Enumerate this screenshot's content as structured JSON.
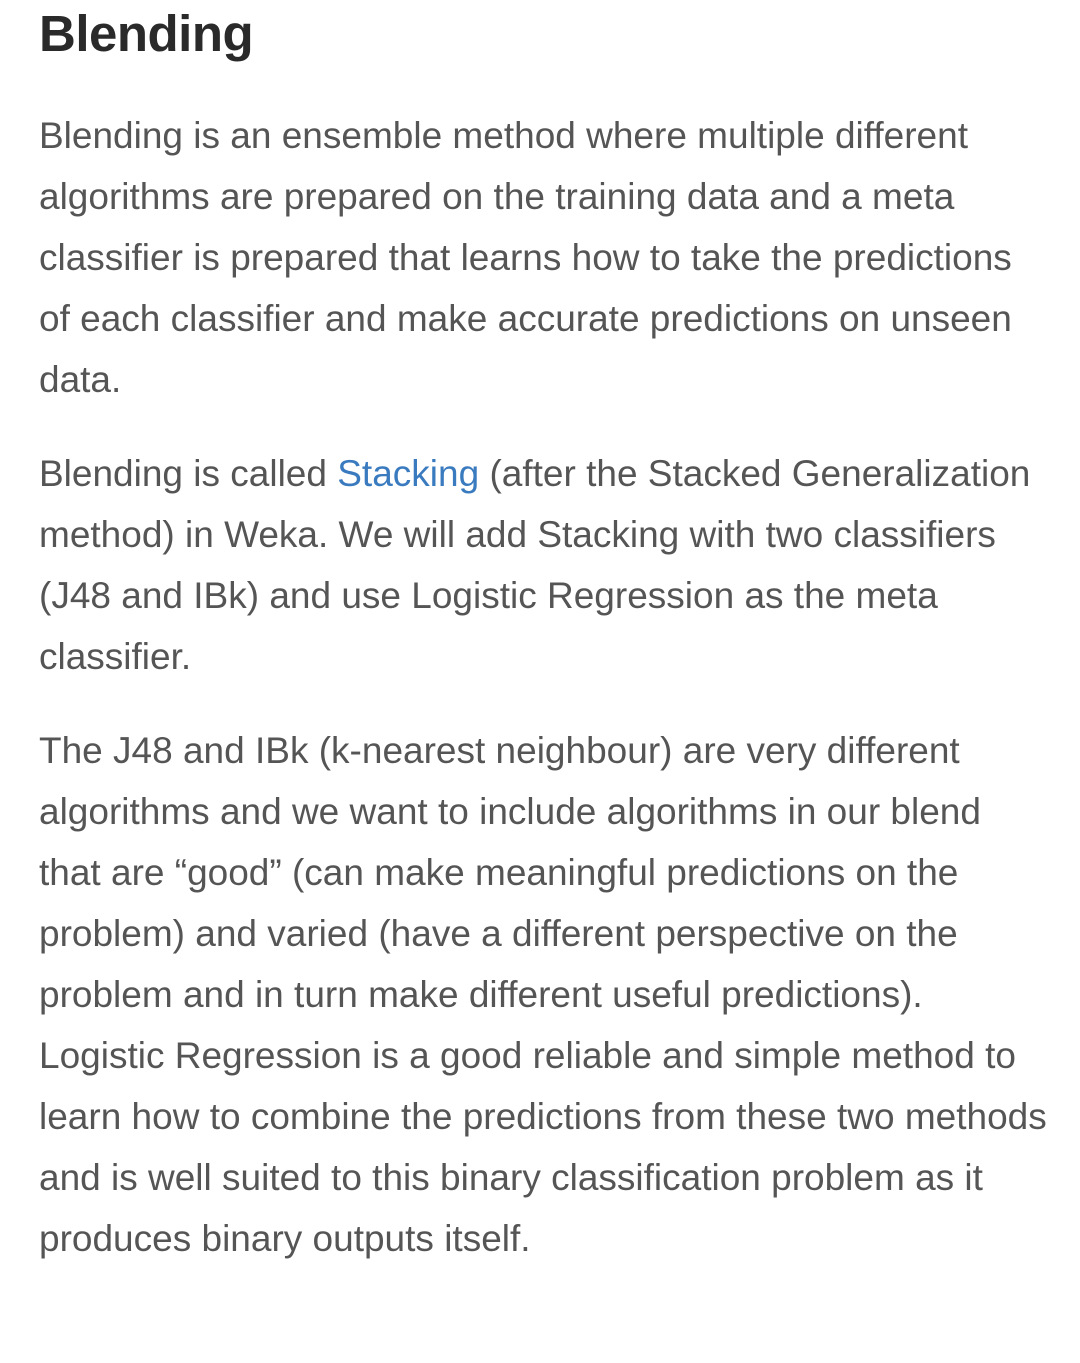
{
  "article": {
    "heading": "Blending",
    "paragraph1": "Blending is an ensemble method where multiple different algorithms are prepared on the training data and a meta classifier is prepared that learns how to take the predictions of each classifier and make accurate predictions on unseen data.",
    "paragraph2": {
      "before_link": "Blending is called ",
      "link_text": "Stacking",
      "after_link": " (after the Stacked Generalization method) in Weka. We will add Stacking with two classifiers (J48 and IBk) and use Logistic Regression as the meta classifier."
    },
    "paragraph3": "The J48 and IBk (k-nearest neighbour) are very different algorithms and we want to include algorithms in our blend that are “good” (can make meaningful predictions on the problem) and varied (have a different perspective on the problem and in turn make different useful predictions). Logistic Regression is a good reliable and simple method to learn how to combine the predictions from these two methods and is well suited to this binary classification problem as it produces binary outputs itself."
  },
  "colors": {
    "heading": "#2a2a2a",
    "body_text": "#555555",
    "link": "#3a7bbf",
    "background": "#ffffff"
  }
}
